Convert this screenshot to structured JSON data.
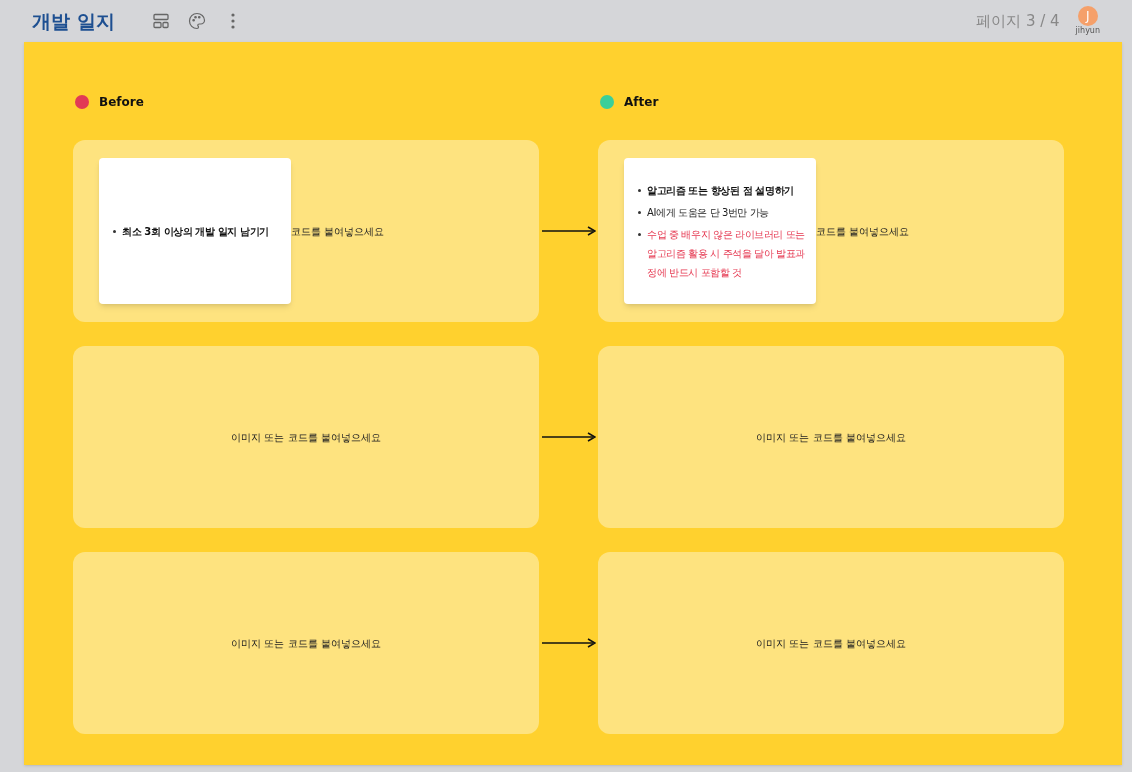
{
  "header": {
    "title": "개발 일지",
    "page": "페이지 3 / 4"
  },
  "user": {
    "initial": "J",
    "name": "jihyun"
  },
  "columns": [
    {
      "label": "Before",
      "color": "#e23a55"
    },
    {
      "label": "After",
      "color": "#3ccf9a"
    }
  ],
  "rows": [
    {
      "before": {
        "placeholder": "코드를 붙여넣으세요",
        "note": [
          {
            "text": "최소 3회 이상의 개발 일지 남기기",
            "kind": "bold"
          }
        ]
      },
      "after": {
        "placeholder": "코드를 붙여넣으세요",
        "note": [
          {
            "text": "알고리즘 또는 향상된 점 설명하기",
            "kind": "bold"
          },
          {
            "text": "AI에게 도움은 단 3번만 가능",
            "kind": "normal"
          },
          {
            "text": "수업 중 배우지 않은 라이브러리 또는 알고리즘 활용 시 주석을 달아 발표과정에 반드시 포함할 것",
            "kind": "warning"
          }
        ]
      }
    },
    {
      "before": {
        "placeholder": "이미지 또는 코드를 붙여넣으세요"
      },
      "after": {
        "placeholder": "이미지 또는 코드를 붙여넣으세요"
      }
    },
    {
      "before": {
        "placeholder": "이미지 또는 코드를 붙여넣으세요"
      },
      "after": {
        "placeholder": "이미지 또는 코드를 붙여넣으세요"
      }
    }
  ]
}
